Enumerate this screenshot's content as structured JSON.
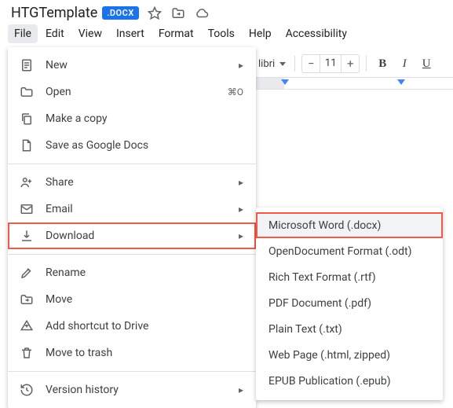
{
  "doc": {
    "title": "HTGTemplate",
    "badge": ".DOCX"
  },
  "menubar": {
    "items": [
      "File",
      "Edit",
      "View",
      "Insert",
      "Format",
      "Tools",
      "Help",
      "Accessibility"
    ]
  },
  "toolbar": {
    "font_name": "libri",
    "font_size": "11"
  },
  "file_menu": {
    "new": "New",
    "open": "Open",
    "open_shortcut": "⌘O",
    "make_copy": "Make a copy",
    "save_as_gdocs": "Save as Google Docs",
    "share": "Share",
    "email": "Email",
    "download": "Download",
    "rename": "Rename",
    "move": "Move",
    "add_shortcut": "Add shortcut to Drive",
    "move_to_trash": "Move to trash",
    "version_history": "Version history"
  },
  "download_submenu": {
    "items": [
      "Microsoft Word (.docx)",
      "OpenDocument Format (.odt)",
      "Rich Text Format (.rtf)",
      "PDF Document (.pdf)",
      "Plain Text (.txt)",
      "Web Page (.html, zipped)",
      "EPUB Publication (.epub)"
    ]
  }
}
